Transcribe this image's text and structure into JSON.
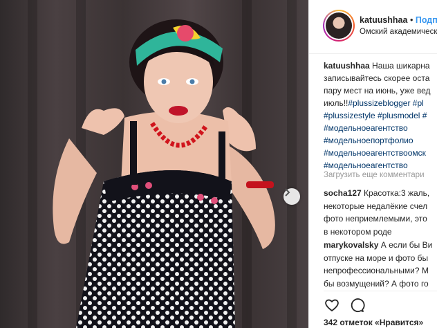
{
  "post": {
    "username": "katuushhaa",
    "dot": "•",
    "follow_label": "Подп",
    "location": "Омский академическ"
  },
  "caption": {
    "username": "katuushhaa",
    "line1": "Наша шикарна",
    "line2": "записывайтесь скорее оста",
    "line3": "пару мест на июнь, уже вед",
    "line4_text": "июль!!",
    "line4_tag": "#plussizeblogger #pl",
    "line5": "#plussizestyle #plusmodel #",
    "line6": "#модельноеагентство",
    "line7": "#модельноепортфолио",
    "line8": "#модельноеагентствоомск",
    "line9": "#модельноеагентство"
  },
  "load_more": "Загрузить еще комментари",
  "comments": [
    {
      "username": "socha127",
      "line1": "Красотка:3 жаль,",
      "line2": "некоторые недалёкие счел",
      "line3": "фото неприемлемыми, это",
      "line4": "в некотором роде"
    },
    {
      "username": "marykovalsky",
      "line1": "А если бы Ви",
      "line2": "отпуске на море и фото бы",
      "line3": "непрофессиональными? М",
      "line4": "бы возмущений? А фото го"
    }
  ],
  "actions": {
    "like_icon": "heart-icon",
    "comment_icon": "comment-icon"
  },
  "likes_text": "342 отметок «Нравится»",
  "colors": {
    "link": "#3897f0",
    "hashtag": "#003569",
    "muted": "#999999",
    "text": "#262626"
  }
}
